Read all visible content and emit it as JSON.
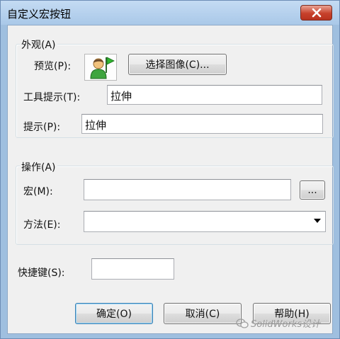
{
  "window": {
    "title": "自定义宏按钮"
  },
  "appearance": {
    "group_label": "外观(A)",
    "preview_label": "预览(P):",
    "preview_icon": "user-with-green-flag-icon",
    "choose_image_button": "选择图像(C)...",
    "tooltip_label": "工具提示(T):",
    "tooltip_value": "拉伸",
    "prompt_label": "提示(P):",
    "prompt_value": "拉伸"
  },
  "action": {
    "group_label": "操作(A)",
    "macro_label": "宏(M):",
    "macro_value": "",
    "browse_button": "...",
    "method_label": "方法(E):",
    "method_value": ""
  },
  "shortcut": {
    "label": "快捷键(S):",
    "value": ""
  },
  "buttons": {
    "ok": "确定(O)",
    "cancel": "取消(C)",
    "help": "帮助(H)"
  },
  "watermark": {
    "text": "SolidWorks设计"
  },
  "colors": {
    "title_bar": "#b6d1ee",
    "close_button": "#c7412b",
    "dialog_background": "#f0f0f0",
    "default_button_border": "#3c7fb1"
  }
}
